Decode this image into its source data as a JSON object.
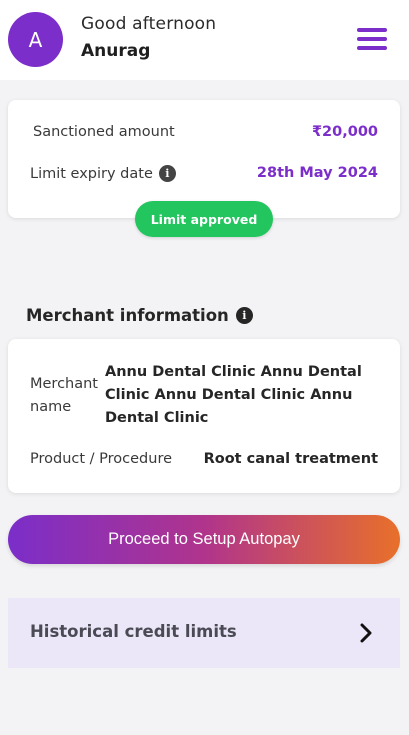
{
  "header": {
    "avatar_initial": "A",
    "greeting": "Good afternoon",
    "user_name": "Anurag",
    "menu_icon": "hamburger-menu-icon"
  },
  "limit_card": {
    "sanctioned_label": "Sanctioned amount",
    "sanctioned_value": "₹20,000",
    "expiry_label": "Limit expiry date",
    "expiry_value": "28th May 2024",
    "status_badge": "Limit approved"
  },
  "merchant": {
    "section_title": "Merchant information",
    "name_label": "Merchant name",
    "name_value": "Annu Dental Clinic Annu Dental Clinic Annu Dental Clinic Annu Dental Clinic",
    "product_label": "Product / Procedure",
    "product_value": "Root canal treatment"
  },
  "actions": {
    "autopay_button": "Proceed to Setup Autopay"
  },
  "history": {
    "label": "Historical credit limits"
  },
  "colors": {
    "primary": "#7b2ec9",
    "success": "#22c55e",
    "gradient_end": "#e8702a",
    "history_bg": "#ece7f8"
  }
}
